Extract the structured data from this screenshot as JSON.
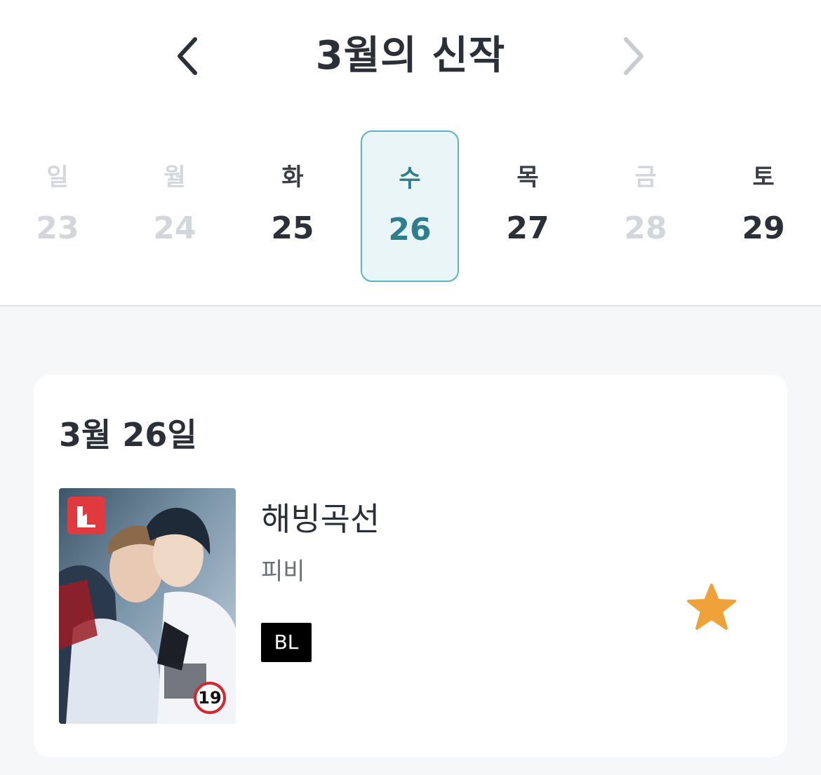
{
  "header": {
    "title": "3월의 신작",
    "prev_icon": "chevron-left-icon",
    "next_icon": "chevron-right-icon"
  },
  "week": [
    {
      "dow": "일",
      "date": "23",
      "state": "disabled"
    },
    {
      "dow": "월",
      "date": "24",
      "state": "disabled"
    },
    {
      "dow": "화",
      "date": "25",
      "state": "enabled"
    },
    {
      "dow": "수",
      "date": "26",
      "state": "selected"
    },
    {
      "dow": "목",
      "date": "27",
      "state": "enabled"
    },
    {
      "dow": "금",
      "date": "28",
      "state": "disabled"
    },
    {
      "dow": "토",
      "date": "29",
      "state": "enabled"
    }
  ],
  "card": {
    "date_label": "3월 26일",
    "items": [
      {
        "title": "해빙곡선",
        "author": "피비",
        "genre": "BL",
        "age_badge": "19",
        "favorite_icon": "star-icon"
      }
    ]
  },
  "colors": {
    "accent": "#2f7e8e",
    "selected_bg": "#eaf5f8",
    "selected_border": "#5fb3c0",
    "star": "#f0a23a",
    "age_badge_red": "#d8262c",
    "logo_red": "#e03a3e"
  }
}
